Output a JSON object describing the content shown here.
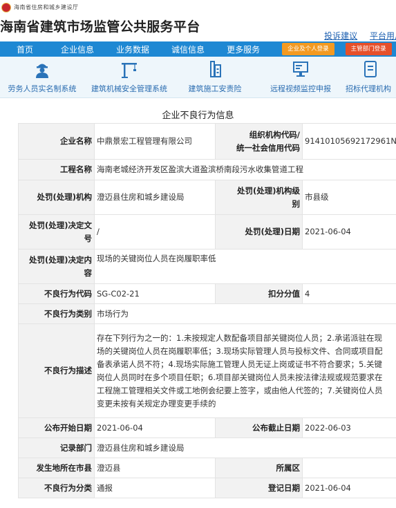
{
  "header": {
    "org": "海南省住房和城乡建设厅",
    "title": "海南省建筑市场监管公共服务平台",
    "links": [
      "投诉建议",
      "平台用户"
    ]
  },
  "nav": {
    "items": [
      "首页",
      "企业信息",
      "业务数据",
      "诚信信息",
      "更多服务"
    ],
    "login_enterprise": "企业及个人登录",
    "login_dept": "主管部门登录"
  },
  "systems": [
    {
      "label": "劳务人员实名制系统",
      "icon": "worker-icon"
    },
    {
      "label": "建筑机械安全管理系统",
      "icon": "crane-icon"
    },
    {
      "label": "建筑施工安责险",
      "icon": "insurance-icon"
    },
    {
      "label": "远程视频监控申报",
      "icon": "video-monitor-icon"
    },
    {
      "label": "招标代理机构",
      "icon": "document-icon"
    }
  ],
  "page_title": "企业不良行为信息",
  "record": {
    "company_name_label": "企业名称",
    "company_name": "中鼎景宏工程管理有限公司",
    "org_code_label_1": "组织机构代码/",
    "org_code_label_2": "统一社会信用代码",
    "org_code": "91410105692172961N",
    "project_label": "工程名称",
    "project": "海南老城经济开发区盈滨大道盈滨桥南段污水收集管道工程",
    "authority_label": "处罚(处理)机构",
    "authority": "澄迈县住房和城乡建设局",
    "authority_level_label_1": "处罚(处理)机构级",
    "authority_level_label_2": "别",
    "authority_level": "市县级",
    "decision_no_label_1": "处罚(处理)决定文",
    "decision_no_label_2": "号",
    "decision_no": "/",
    "penalty_date_label": "处罚(处理)日期",
    "penalty_date": "2021-06-04",
    "decision_content_label_1": "处罚(处理)决定内",
    "decision_content_label_2": "容",
    "decision_content": "现场的关键岗位人员在岗履职率低",
    "behavior_code_label": "不良行为代码",
    "behavior_code": "SG-C02-21",
    "deduction_label": "扣分分值",
    "deduction": "4",
    "behavior_category_label": "不良行为类别",
    "behavior_category": "市场行为",
    "behavior_desc_label": "不良行为描述",
    "behavior_desc_lines": [
      "存在下列行为之一的：1.未按规定人数配备项目部关键岗位人员；2.承诺派驻在现",
      "场的关键岗位人员在岗履职率低；3.现场实际管理人员与投标文件、合同或项目配",
      "备表承诺人员不符；4.现场实际施工管理人员无证上岗或证书不符合要求；5.关键",
      "岗位人员同时在多个项目任职；6.项目部关键岗位人员未按法律法规或规范要求在",
      "工程施工管理相关文件或工地例会纪要上签字，或由他人代签的；7.关键岗位人员",
      "变更未按有关规定办理变更手续的"
    ],
    "publish_start_label": "公布开始日期",
    "publish_start": "2021-06-04",
    "publish_end_label": "公布截止日期",
    "publish_end": "2022-06-03",
    "record_dept_label": "记录部门",
    "record_dept": "澄迈县住房和城乡建设局",
    "location_city_label": "发生地所在市县",
    "location_city": "澄迈县",
    "district_label": "所属区",
    "district": "",
    "classification_label": "不良行为分类",
    "classification": "通报",
    "record_date_label": "登记日期",
    "record_date": "2021-06-04"
  }
}
